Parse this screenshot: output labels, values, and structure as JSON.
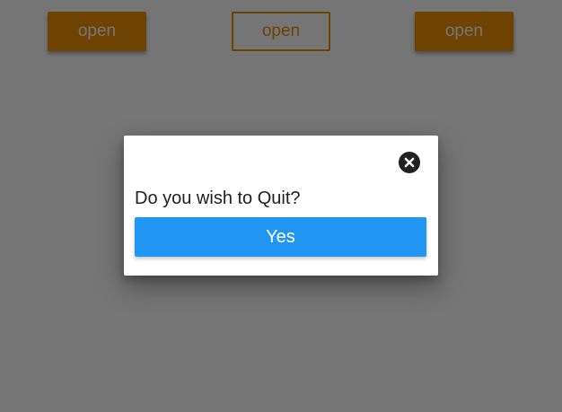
{
  "colors": {
    "accent_orange": "#f09000",
    "primary_blue": "#2196f3",
    "overlay": "#000000"
  },
  "buttons": {
    "open_left_label": "open",
    "open_middle_label": "open",
    "open_right_label": "open"
  },
  "dialog": {
    "message": "Do you wish to Quit?",
    "confirm_label": "Yes",
    "close_icon": "close-circle-icon"
  }
}
